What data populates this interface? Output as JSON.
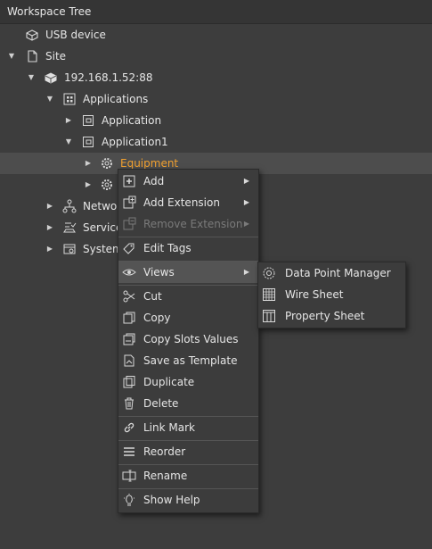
{
  "panel": {
    "title": "Workspace Tree"
  },
  "tree": {
    "usb": "USB device",
    "site": "Site",
    "ip": "192.168.1.52:88",
    "applications": "Applications",
    "application": "Application",
    "application1": "Application1",
    "equipment": "Equipment",
    "network": "Network",
    "services": "Service",
    "system": "System"
  },
  "menu": {
    "add": "Add",
    "add_extension": "Add Extension",
    "remove_extension": "Remove Extension",
    "edit_tags": "Edit Tags",
    "views": "Views",
    "cut": "Cut",
    "copy": "Copy",
    "copy_slots": "Copy Slots Values",
    "save_template": "Save as Template",
    "duplicate": "Duplicate",
    "delete": "Delete",
    "link_mark": "Link Mark",
    "reorder": "Reorder",
    "rename": "Rename",
    "show_help": "Show Help"
  },
  "submenu": {
    "data_point_manager": "Data Point Manager",
    "wire_sheet": "Wire Sheet",
    "property_sheet": "Property Sheet"
  },
  "colors": {
    "selected_text": "#f0a030",
    "background": "#3d3d3d",
    "highlight": "#545454"
  }
}
